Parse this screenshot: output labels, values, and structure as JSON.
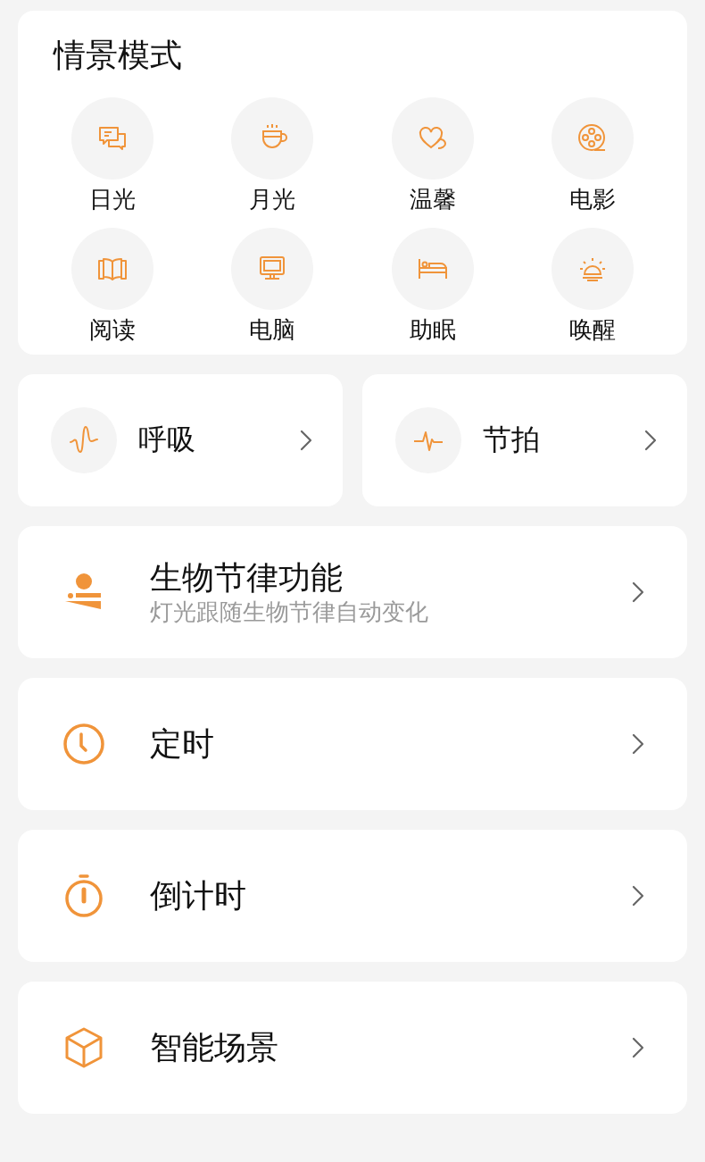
{
  "scene_modes": {
    "title": "情景模式",
    "items": [
      {
        "label": "日光"
      },
      {
        "label": "月光"
      },
      {
        "label": "温馨"
      },
      {
        "label": "电影"
      },
      {
        "label": "阅读"
      },
      {
        "label": "电脑"
      },
      {
        "label": "助眠"
      },
      {
        "label": "唤醒"
      }
    ]
  },
  "effects": [
    {
      "label": "呼吸"
    },
    {
      "label": "节拍"
    }
  ],
  "features": [
    {
      "title": "生物节律功能",
      "subtitle": "灯光跟随生物节律自动变化"
    },
    {
      "title": "定时"
    },
    {
      "title": "倒计时"
    },
    {
      "title": "智能场景"
    }
  ]
}
